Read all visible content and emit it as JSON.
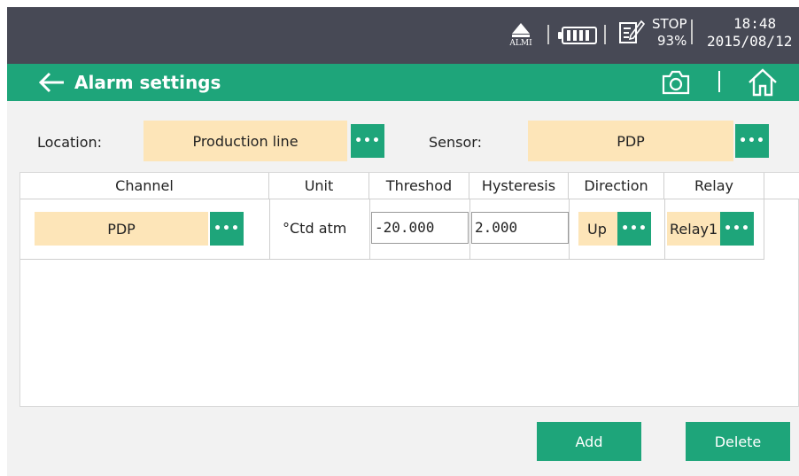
{
  "status_bar": {
    "alarm_label": "ALMI",
    "stop_label": "STOP",
    "battery_percent": "93%",
    "time": "18:48",
    "date": "2015/08/12"
  },
  "header": {
    "title": "Alarm settings",
    "back_icon": "arrow-left-icon",
    "camera_icon": "camera-icon",
    "home_icon": "home-icon"
  },
  "filters": {
    "location_label": "Location:",
    "location_value": "Production line",
    "sensor_label": "Sensor:",
    "sensor_value": "PDP",
    "more_label": "•••"
  },
  "table": {
    "headers": [
      "Channel",
      "Unit",
      "Threshod",
      "Hysteresis",
      "Direction",
      "Relay"
    ],
    "rows": [
      {
        "channel": "PDP",
        "unit": "°Ctd atm",
        "threshold": "-20.000",
        "hysteresis": "2.000",
        "direction": "Up",
        "relay": "Relay1"
      }
    ]
  },
  "actions": {
    "add_label": "Add",
    "delete_label": "Delete"
  },
  "colors": {
    "accent": "#1ea57a",
    "status_bar": "#474955",
    "select_bg": "#fde5b8",
    "content_bg": "#f2f2f2"
  }
}
